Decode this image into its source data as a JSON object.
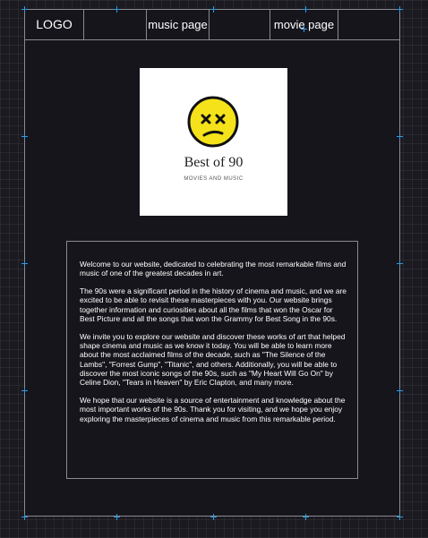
{
  "nav": {
    "logo": "LOGO",
    "music_page": "music page",
    "movie_page": "movie page"
  },
  "logo_card": {
    "title": "Best of 90",
    "subtitle": "MOVIES AND MUSIC"
  },
  "content": {
    "paragraphs": [
      "Welcome to our website, dedicated to celebrating the most remarkable films and music of one of the greatest decades in art.",
      "The 90s were a significant period in the history of cinema and music, and we are excited to be able to revisit these masterpieces with you. Our website brings together information and curiosities about all the films that won the Oscar for Best Picture and all the songs that won the Grammy for Best Song in the 90s.",
      "We invite you to explore our website and discover these works of art that helped shape cinema and music as we know it today. You will be able to learn more about the most acclaimed films of the decade, such as \"The Silence of the Lambs\", \"Forrest Gump\", \"Titanic\", and others. Additionally, you will be able to discover the most iconic songs of the 90s, such as \"My Heart Will Go On\" by Celine Dion, \"Tears in Heaven\" by Eric Clapton, and many more.",
      "We hope that our website is a source of entertainment and knowledge about the most important works of the 90s. Thank you for visiting, and we hope you enjoy exploring the masterpieces of cinema and music from this remarkable period."
    ]
  },
  "colors": {
    "background": "#1b1a20",
    "frame": "#16151b",
    "border": "#8a8a90",
    "selection_handle": "#2f9be0",
    "emoji_yellow": "#f5e21a"
  }
}
